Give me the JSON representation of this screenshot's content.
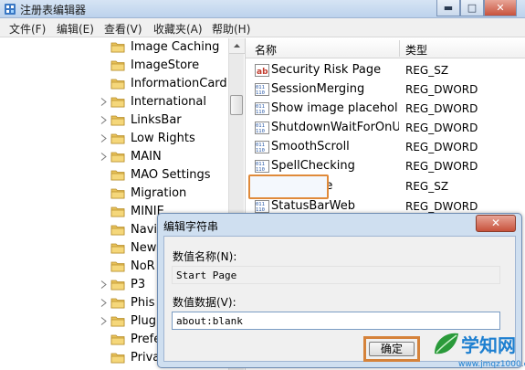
{
  "window": {
    "title": "注册表编辑器"
  },
  "menu": [
    "文件(F)",
    "编辑(E)",
    "查看(V)",
    "收藏夹(A)",
    "帮助(H)"
  ],
  "tree": [
    {
      "label": "Image Caching",
      "expandable": false
    },
    {
      "label": "ImageStore",
      "expandable": false
    },
    {
      "label": "InformationCard T",
      "expandable": false
    },
    {
      "label": "International",
      "expandable": true
    },
    {
      "label": "LinksBar",
      "expandable": true
    },
    {
      "label": "Low Rights",
      "expandable": true
    },
    {
      "label": "MAIN",
      "expandable": true
    },
    {
      "label": "MAO Settings",
      "expandable": false
    },
    {
      "label": "Migration",
      "expandable": false
    },
    {
      "label": "MINIE",
      "expandable": false
    },
    {
      "label": "Navi",
      "expandable": false
    },
    {
      "label": "New",
      "expandable": false
    },
    {
      "label": "NoR",
      "expandable": false
    },
    {
      "label": "P3",
      "expandable": true
    },
    {
      "label": "Phis",
      "expandable": true
    },
    {
      "label": "Plug",
      "expandable": true
    },
    {
      "label": "Prefe",
      "expandable": false
    },
    {
      "label": "Priva",
      "expandable": false
    }
  ],
  "columns": {
    "name": "名称",
    "type": "类型"
  },
  "values": [
    {
      "name": "Security Risk Page",
      "type": "REG_SZ",
      "icon": "ab"
    },
    {
      "name": "SessionMerging",
      "type": "REG_DWORD",
      "icon": "bin"
    },
    {
      "name": "Show image placehol...",
      "type": "REG_DWORD",
      "icon": "bin"
    },
    {
      "name": "ShutdownWaitForOnU...",
      "type": "REG_DWORD",
      "icon": "bin"
    },
    {
      "name": "SmoothScroll",
      "type": "REG_DWORD",
      "icon": "bin"
    },
    {
      "name": "SpellChecking",
      "type": "REG_DWORD",
      "icon": "bin"
    },
    {
      "name": "Start Page",
      "type": "REG_SZ",
      "icon": "ab"
    },
    {
      "name": "StatusBarWeb",
      "type": "REG_DWORD",
      "icon": "bin"
    }
  ],
  "dialog": {
    "title": "编辑字符串",
    "name_label": "数值名称(N):",
    "name_value": "Start Page",
    "data_label": "数值数据(V):",
    "data_value": "about:blank",
    "ok_label": "确定"
  },
  "watermark": {
    "text": "学知网",
    "url": "www.jmqz1000.com"
  }
}
